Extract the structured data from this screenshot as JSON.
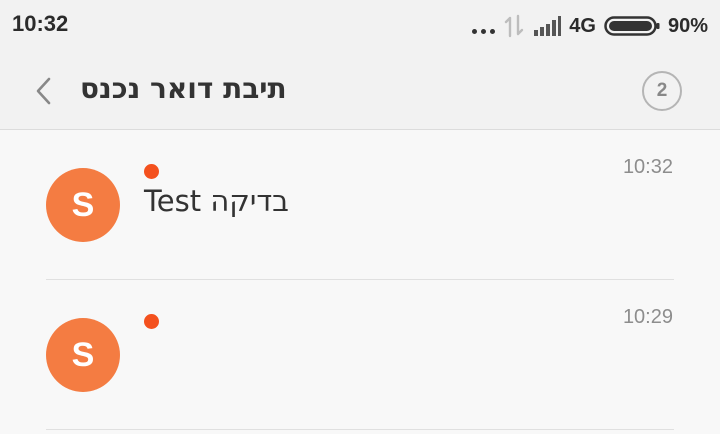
{
  "status_bar": {
    "time": "10:32",
    "network": "4G",
    "battery": "90%",
    "icons": [
      "more-dots-icon",
      "data-transfer-icon",
      "signal-icon",
      "battery-icon"
    ]
  },
  "header": {
    "title": "תיבת דואר נכנס",
    "count": "2",
    "back_icon": "chevron-left-icon"
  },
  "colors": {
    "avatar": "#f47c42",
    "unread": "#f4511e"
  },
  "messages": [
    {
      "avatar_letter": "S",
      "time": "10:32",
      "preview": "בדיקה Test",
      "unread": true
    },
    {
      "avatar_letter": "S",
      "time": "10:29",
      "preview": "",
      "unread": true
    }
  ]
}
